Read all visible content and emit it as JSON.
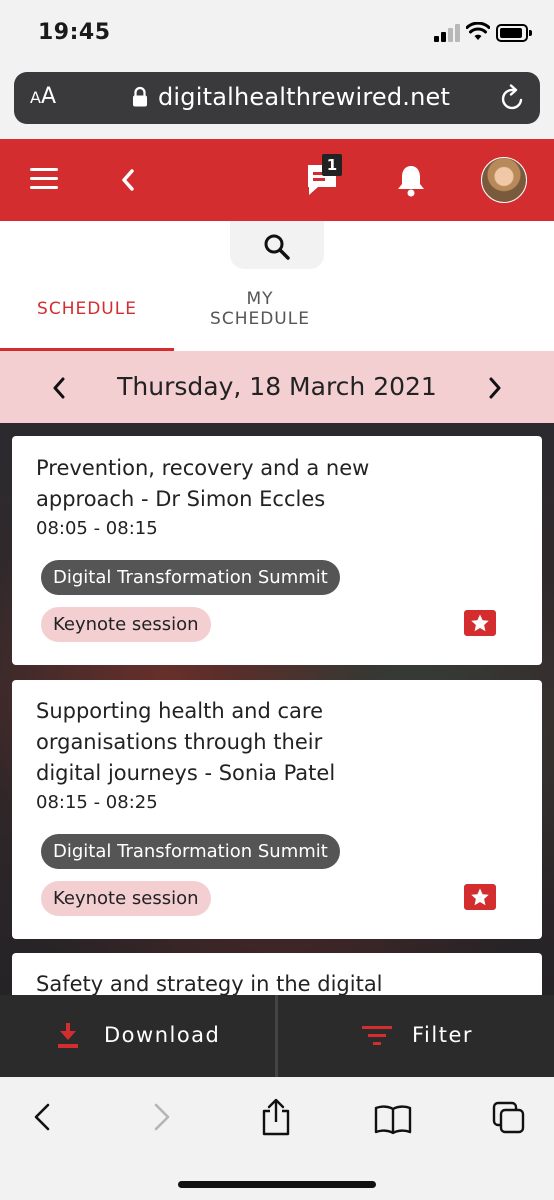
{
  "status_bar": {
    "time": "19:45"
  },
  "browser": {
    "text_size_label": "AA",
    "url": "digitalhealthrewired.net"
  },
  "header": {
    "chat_badge": "1"
  },
  "tabs": {
    "schedule": "SCHEDULE",
    "my_schedule_line1": "MY",
    "my_schedule_line2": "SCHEDULE"
  },
  "date_nav": {
    "date": "Thursday, 18 March 2021"
  },
  "sessions": [
    {
      "title_line1": "Prevention, recovery and a new",
      "title_line2": "approach - Dr Simon Eccles",
      "time": "08:05 - 08:15",
      "track": "Digital Transformation Summit",
      "type": "Keynote session"
    },
    {
      "title_line1": "Supporting health and care",
      "title_line2": "organisations through their",
      "title_line3": "digital journeys - Sonia Patel",
      "time": "08:15 - 08:25",
      "track": "Digital Transformation Summit",
      "type": "Keynote session"
    },
    {
      "title_line1": "Safety and strategy in the digital"
    }
  ],
  "actions": {
    "download": "Download",
    "filter": "Filter"
  },
  "colors": {
    "brand_red": "#d32d2f",
    "date_bar_pink": "#f3cfd2",
    "tag_dark": "#555555",
    "action_bar": "#2b2b2b"
  },
  "icons": [
    "lock-icon",
    "reload-icon",
    "hamburger-icon",
    "back-chevron-icon",
    "chat-icon",
    "bell-icon",
    "search-icon",
    "chevron-left-icon",
    "chevron-right-icon",
    "star-ticket-icon",
    "download-icon",
    "filter-icon",
    "safari-back-icon",
    "safari-forward-icon",
    "share-icon",
    "bookmarks-icon",
    "tabs-icon"
  ]
}
